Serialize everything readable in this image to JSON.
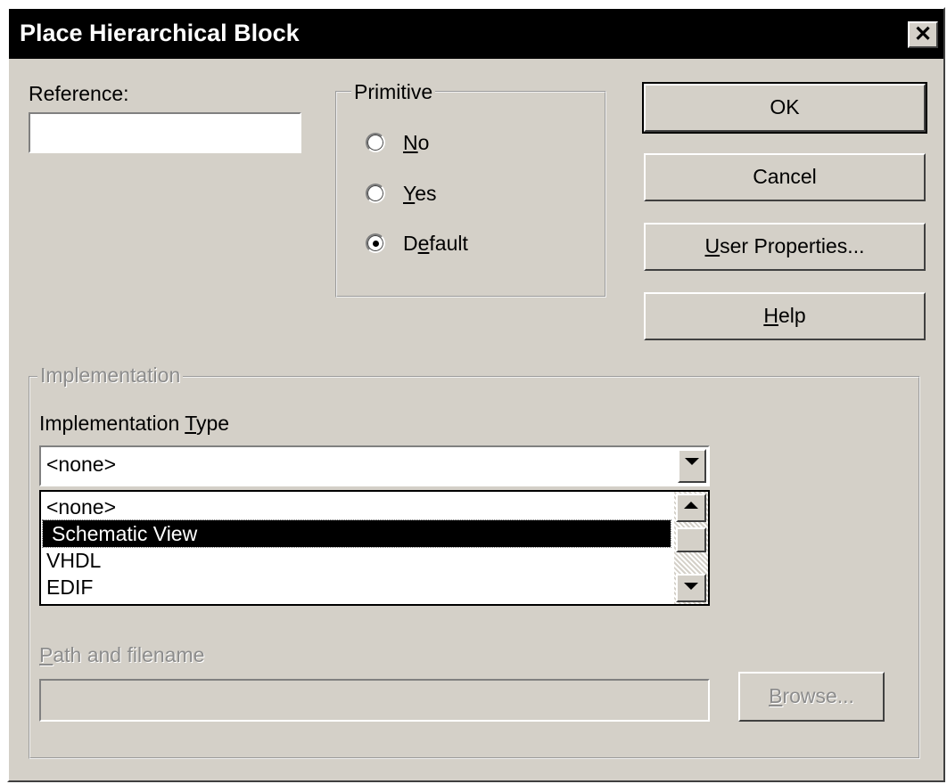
{
  "window": {
    "title": "Place Hierarchical Block",
    "close_glyph": "✕"
  },
  "reference": {
    "label": "Reference:",
    "value": ""
  },
  "primitive": {
    "legend": "Primitive",
    "options": [
      {
        "label": "No",
        "selected": false
      },
      {
        "label": "Yes",
        "selected": false
      },
      {
        "label": "Default",
        "selected": true
      }
    ]
  },
  "buttons": {
    "ok": "OK",
    "cancel": "Cancel",
    "user_properties": "User Properties...",
    "help": "Help"
  },
  "implementation": {
    "legend": "Implementation",
    "type_label": "Implementation Type",
    "type_value": "<none>",
    "options": [
      "<none>",
      "Schematic View",
      "VHDL",
      "EDIF"
    ],
    "highlighted_option": "Schematic View",
    "path_label": "Path and filename",
    "path_value": "",
    "browse": "Browse..."
  }
}
